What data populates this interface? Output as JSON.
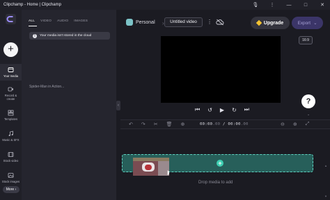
{
  "window": {
    "title": "Clipchamp - Home | Clipchamp",
    "controls": [
      "mic-icon",
      "kebab-icon",
      "minimize",
      "maximize",
      "close"
    ]
  },
  "rail": {
    "items": [
      {
        "label": "Your media",
        "icon": "media-icon",
        "active": true
      },
      {
        "label": "Record & create",
        "icon": "record-icon"
      },
      {
        "label": "Templates",
        "icon": "templates-icon"
      },
      {
        "label": "Music & SFX",
        "icon": "music-icon"
      },
      {
        "label": "Stock video",
        "icon": "stock-video-icon"
      },
      {
        "label": "Stock images",
        "icon": "stock-images-icon"
      }
    ],
    "more_label": "More"
  },
  "media": {
    "tabs": [
      "ALL",
      "VIDEO",
      "AUDIO",
      "IMAGES"
    ],
    "active_tab": "ALL",
    "notice": "Your media isn't stored in the cloud",
    "clip_name": "Spider-Man in Action..."
  },
  "topbar": {
    "workspace": "Personal",
    "video_title": "Untitled video",
    "upgrade_label": "Upgrade",
    "export_label": "Export"
  },
  "preview": {
    "aspect_ratio": "16:9",
    "help_label": "?"
  },
  "timeline": {
    "time_current": "00:00",
    "time_current_frac": ".00",
    "time_separator": "/",
    "time_total": "00:00",
    "time_total_frac": ".00",
    "drop_hint": "Drop media to add"
  },
  "colors": {
    "accent": "#3ecfb2",
    "upgrade_icon": "#f2c232",
    "export_bg": "#3b3568"
  }
}
